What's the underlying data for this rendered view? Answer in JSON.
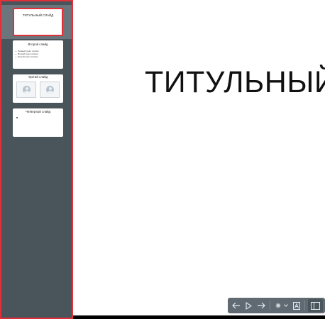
{
  "slides": [
    {
      "title": "ТИТУЛЬНЫЙ СЛАЙД",
      "active": true
    },
    {
      "title": "Второй слайд",
      "bullets": [
        "Первый пункт списка",
        "Второй пункт списка",
        "Третий пункт списка"
      ]
    },
    {
      "title": "Третий слайд",
      "images": [
        "image-placeholder",
        "image-placeholder"
      ]
    },
    {
      "title": "Четвертый слайд"
    }
  ],
  "main": {
    "title": "ТИТУЛЬНЫЙ"
  },
  "toolbar": {
    "buttons": [
      "arrow-left-icon",
      "play-icon",
      "arrow-right-icon",
      "pointer-icon",
      "chevron-down-icon",
      "text-a-icon",
      "panel-toggle-icon"
    ]
  },
  "colors": {
    "sidebar": "#4a545b",
    "active_border": "#e0303a",
    "toolbar": "#5f6a72"
  }
}
